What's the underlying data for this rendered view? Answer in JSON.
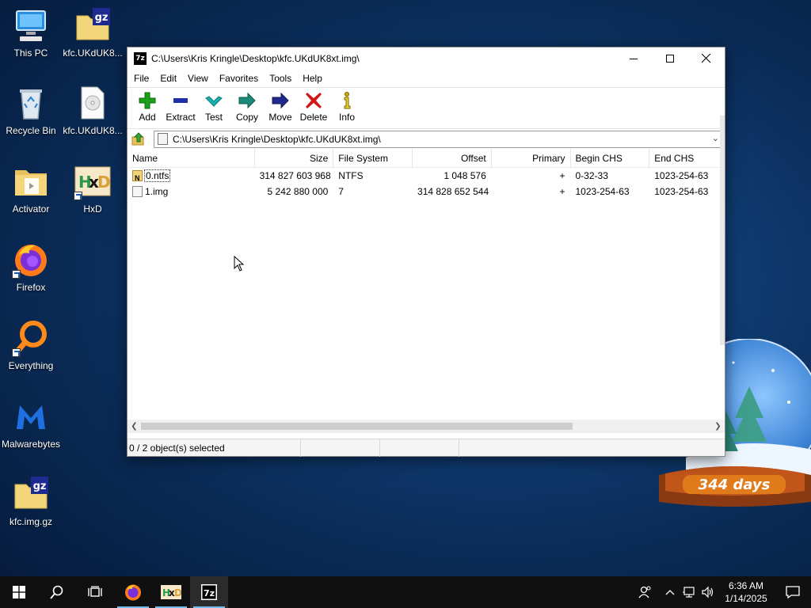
{
  "desktop": {
    "icons": [
      {
        "label": "This PC"
      },
      {
        "label": "kfc.UKdUK8..."
      },
      {
        "label": "Recycle Bin"
      },
      {
        "label": "kfc.UKdUK8..."
      },
      {
        "label": "Activator"
      },
      {
        "label": "HxD"
      },
      {
        "label": "Firefox"
      },
      {
        "label": "Everything"
      },
      {
        "label": "Malwarebytes"
      },
      {
        "label": "kfc.img.gz"
      }
    ],
    "globe_text": "344 days"
  },
  "window": {
    "app_icon_text": "7z",
    "title": "C:\\Users\\Kris Kringle\\Desktop\\kfc.UKdUK8xt.img\\",
    "menu": [
      "File",
      "Edit",
      "View",
      "Favorites",
      "Tools",
      "Help"
    ],
    "toolbar": [
      {
        "label": "Add",
        "icon": "plus-icon",
        "color": "#1aa01a"
      },
      {
        "label": "Extract",
        "icon": "minus-icon",
        "color": "#1f2fa8"
      },
      {
        "label": "Test",
        "icon": "check-icon",
        "color": "#1ab0b0"
      },
      {
        "label": "Copy",
        "icon": "arrow-right-icon",
        "color": "#1a8a7a"
      },
      {
        "label": "Move",
        "icon": "arrow-right-icon",
        "color": "#1f2a90"
      },
      {
        "label": "Delete",
        "icon": "x-icon",
        "color": "#d01818"
      },
      {
        "label": "Info",
        "icon": "info-icon",
        "color": "#c8a800"
      }
    ],
    "address": "C:\\Users\\Kris Kringle\\Desktop\\kfc.UKdUK8xt.img\\",
    "columns": [
      "Name",
      "Size",
      "File System",
      "Offset",
      "Primary",
      "Begin CHS",
      "End CHS"
    ],
    "rows": [
      {
        "name": "0.ntfs",
        "size": "314 827 603 968",
        "fs": "NTFS",
        "offset": "1 048 576",
        "primary": "+",
        "begin_chs": "0-32-33",
        "end_chs": "1023-254-63"
      },
      {
        "name": "1.img",
        "size": "5 242 880 000",
        "fs": "7",
        "offset": "314 828 652 544",
        "primary": "+",
        "begin_chs": "1023-254-63",
        "end_chs": "1023-254-63"
      }
    ],
    "status": "0 / 2 object(s) selected"
  },
  "taskbar": {
    "time": "6:36 AM",
    "date": "1/14/2025",
    "pinned": [
      "start-icon",
      "search-icon",
      "task-view-icon",
      "firefox-icon",
      "hxd-icon",
      "7zip-icon"
    ]
  },
  "colors": {
    "desktop_bg": "#0f3c72",
    "taskbar_bg": "#101010",
    "accent": "#76b9ed"
  }
}
